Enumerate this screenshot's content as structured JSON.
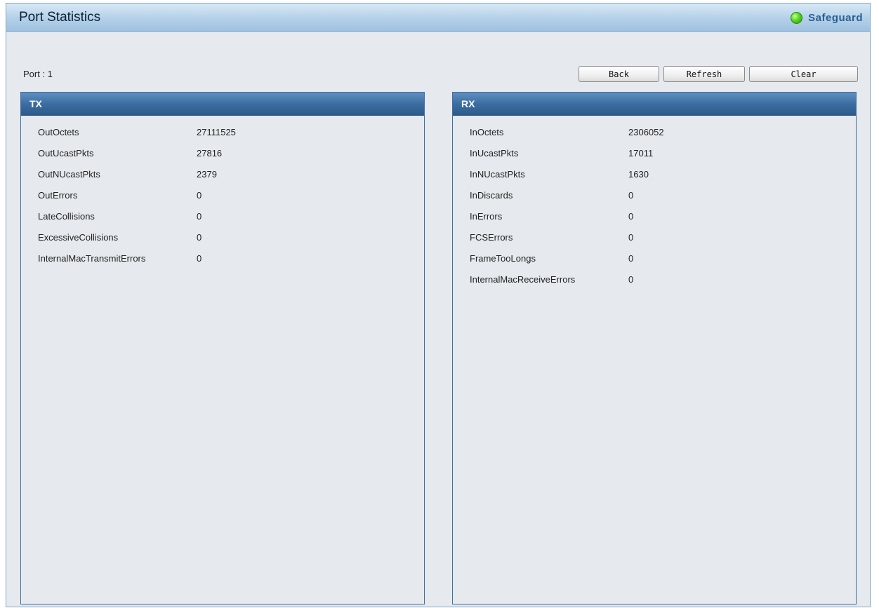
{
  "header": {
    "title": "Port Statistics",
    "safeguard_label": "Safeguard",
    "safeguard_status_color": "#55d61c"
  },
  "port": {
    "label": "Port : 1"
  },
  "buttons": {
    "back": "Back",
    "refresh": "Refresh",
    "clear": "Clear"
  },
  "tx": {
    "title": "TX",
    "stats": [
      {
        "name": "OutOctets",
        "value": "27111525"
      },
      {
        "name": "OutUcastPkts",
        "value": "27816"
      },
      {
        "name": "OutNUcastPkts",
        "value": "2379"
      },
      {
        "name": "OutErrors",
        "value": "0"
      },
      {
        "name": "LateCollisions",
        "value": "0"
      },
      {
        "name": "ExcessiveCollisions",
        "value": "0"
      },
      {
        "name": "InternalMacTransmitErrors",
        "value": "0"
      }
    ]
  },
  "rx": {
    "title": "RX",
    "stats": [
      {
        "name": "InOctets",
        "value": "2306052"
      },
      {
        "name": "InUcastPkts",
        "value": "17011"
      },
      {
        "name": "InNUcastPkts",
        "value": "1630"
      },
      {
        "name": "InDiscards",
        "value": "0"
      },
      {
        "name": "InErrors",
        "value": "0"
      },
      {
        "name": "FCSErrors",
        "value": "0"
      },
      {
        "name": "FrameTooLongs",
        "value": "0"
      },
      {
        "name": "InternalMacReceiveErrors",
        "value": "0"
      }
    ]
  }
}
